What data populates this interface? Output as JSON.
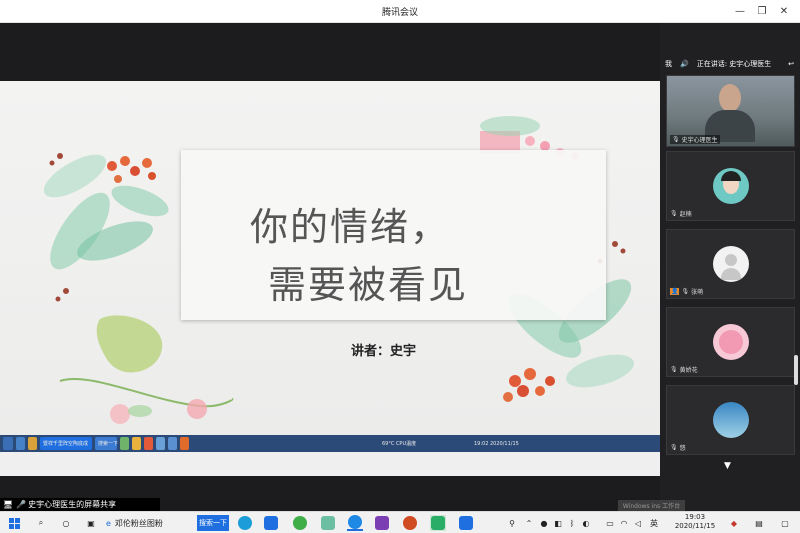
{
  "window": {
    "title": "腾讯会议"
  },
  "slide": {
    "title_line1": "你的情绪，",
    "title_line2": "需要被看见",
    "speaker": "讲者：史宇"
  },
  "remote_taskbar": {
    "items": [
      "暨祥千里阵空陶底成",
      "搜索一下",
      "69°C CPU温度",
      "19:02 2020/11/15"
    ]
  },
  "share_banner": "史宇心理医生的屏幕共享",
  "right_panel": {
    "speaking_prefix": "我",
    "speaking_text": "正在讲话: 史宇心理医生",
    "participants": [
      {
        "name": "史宇心理医生"
      },
      {
        "name": "赵楠"
      },
      {
        "name": "张萌"
      },
      {
        "name": "黄娇花"
      },
      {
        "name": "悠"
      }
    ]
  },
  "taskbar": {
    "ie_label": "邓伦粉丝图粉",
    "search_label": "搜索一下",
    "time": "19:03",
    "date": "2020/11/15",
    "win_version": "Windows ins 工作台"
  },
  "colors": {
    "accent_blue": "#1f6fe0",
    "remote_taskbar": "#2c4a78",
    "tile_bg": "#2b2b2d"
  }
}
